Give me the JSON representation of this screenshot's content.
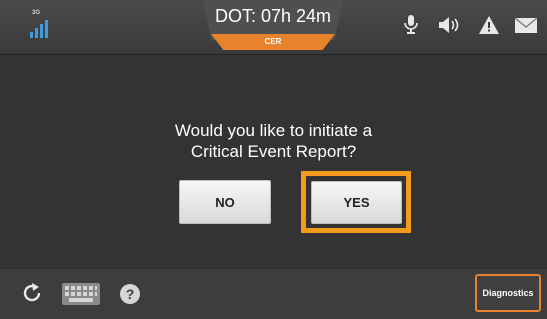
{
  "header": {
    "network": "3G",
    "dot_label": "DOT: 07h 24m",
    "cer_label": "CER",
    "icons": [
      "microphone-icon",
      "speaker-icon",
      "warning-icon",
      "mail-icon"
    ]
  },
  "dialog": {
    "line1": "Would you like to initiate a",
    "line2": "Critical Event Report?",
    "no_label": "NO",
    "yes_label": "YES"
  },
  "footer": {
    "icons": [
      "refresh-icon",
      "keyboard-icon",
      "help-icon"
    ],
    "diagnostics_label": "Diagnostics"
  },
  "colors": {
    "accent": "#f39a1c",
    "cer_tab": "#e8822b",
    "signal": "#3d9be0",
    "background": "#333333"
  }
}
